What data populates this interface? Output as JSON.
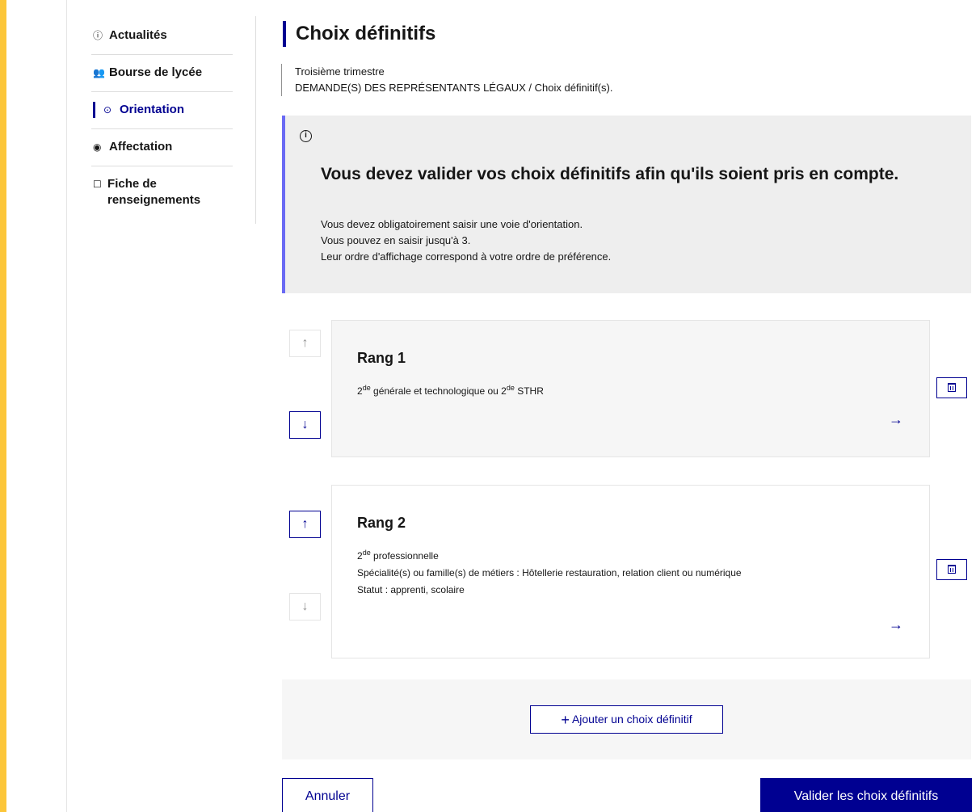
{
  "sidebar": {
    "items": [
      {
        "icon": "ⓘ",
        "label": "Actualités"
      },
      {
        "icon": "👥",
        "label": "Bourse de lycée"
      },
      {
        "icon": "⊙",
        "label": "Orientation"
      },
      {
        "icon": "◉",
        "label": "Affectation"
      },
      {
        "icon": "☐",
        "label": "Fiche de renseignements"
      }
    ]
  },
  "header": {
    "title": "Choix définitifs",
    "subtitle_line1": "Troisième trimestre",
    "subtitle_line2": "DEMANDE(S) DES REPRÉSENTANTS LÉGAUX / Choix définitif(s)."
  },
  "callout": {
    "title": "Vous devez valider vos choix définitifs afin qu'ils soient pris en compte.",
    "line1": "Vous devez obligatoirement saisir une voie d'orientation.",
    "line2": "Vous pouvez en saisir jusqu'à 3.",
    "line3": "Leur ordre d'affichage correspond à votre ordre de préférence."
  },
  "choices": [
    {
      "title": "Rang 1",
      "voie_sup": "de",
      "voie_a": "2",
      "voie_b": " générale et technologique ou 2",
      "voie_c": " STHR"
    },
    {
      "title": "Rang 2",
      "voie_a": "2",
      "voie_sup": "de",
      "voie_b": " professionnelle",
      "specialite": "Spécialité(s) ou famille(s) de métiers : Hôtellerie restauration, relation client ou numérique",
      "statut": "Statut : apprenti, scolaire"
    }
  ],
  "actions": {
    "add_label": "Ajouter un choix définitif",
    "cancel_label": "Annuler",
    "submit_label": "Valider les choix définitifs"
  },
  "colors": {
    "primary": "#000091",
    "accent": "#fcc63a",
    "callout_border": "#6a6af4"
  }
}
